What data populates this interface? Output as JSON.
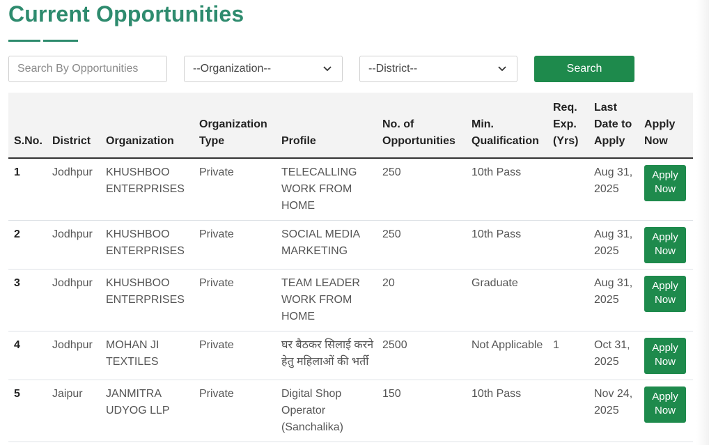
{
  "page": {
    "title": "Current Opportunities"
  },
  "filters": {
    "search_placeholder": "Search By Opportunities",
    "organization": "--Organization--",
    "district": "--District--",
    "search_label": "Search"
  },
  "table": {
    "headers": {
      "sno": "S.No.",
      "district": "District",
      "organization": "Organization",
      "org_type": "Organization Type",
      "profile": "Profile",
      "opportunities": "No. of Opportunities",
      "qualification": "Min. Qualification",
      "experience": "Req. Exp. (Yrs)",
      "last_date": "Last Date to Apply",
      "apply": "Apply Now"
    },
    "rows": [
      {
        "sno": "1",
        "district": "Jodhpur",
        "organization": "KHUSHBOO ENTERPRISES",
        "org_type": "Private",
        "profile": "TELECALLING WORK FROM HOME",
        "opportunities": "250",
        "qualification": "10th Pass",
        "experience": "",
        "last_date": "Aug 31, 2025",
        "apply": "Apply Now"
      },
      {
        "sno": "2",
        "district": "Jodhpur",
        "organization": "KHUSHBOO ENTERPRISES",
        "org_type": "Private",
        "profile": "SOCIAL MEDIA MARKETING",
        "opportunities": "250",
        "qualification": "10th Pass",
        "experience": "",
        "last_date": "Aug 31, 2025",
        "apply": "Apply Now"
      },
      {
        "sno": "3",
        "district": "Jodhpur",
        "organization": "KHUSHBOO ENTERPRISES",
        "org_type": "Private",
        "profile": "TEAM LEADER WORK FROM HOME",
        "opportunities": "20",
        "qualification": "Graduate",
        "experience": "",
        "last_date": "Aug 31, 2025",
        "apply": "Apply Now"
      },
      {
        "sno": "4",
        "district": "Jodhpur",
        "organization": "MOHAN JI TEXTILES",
        "org_type": "Private",
        "profile": "घर बैठकर सिलाई करने हेतु महिलाओं की भर्ती",
        "opportunities": "2500",
        "qualification": "Not Applicable",
        "experience": "1",
        "last_date": "Oct 31, 2025",
        "apply": "Apply Now"
      },
      {
        "sno": "5",
        "district": "Jaipur",
        "organization": "JANMITRA UDYOG LLP",
        "org_type": "Private",
        "profile": "Digital Shop Operator (Sanchalika)",
        "opportunities": "150",
        "qualification": "10th Pass",
        "experience": "",
        "last_date": "Nov 24, 2025",
        "apply": "Apply Now"
      }
    ]
  },
  "colors": {
    "brand_green": "#2e8b6e",
    "button_green": "#1e8a4c"
  },
  "icons": {
    "dropdown": "chevron-down-icon"
  }
}
